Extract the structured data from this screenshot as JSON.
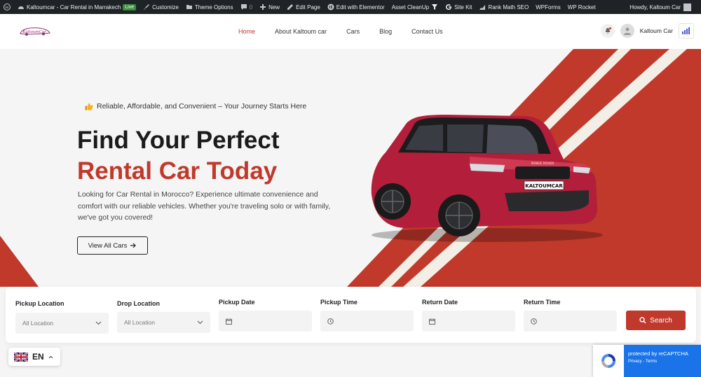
{
  "adminbar": {
    "site_name": "Kaltoumcar - Car Rental in Marrakech",
    "live_badge": "Live",
    "customize": "Customize",
    "theme_options": "Theme Options",
    "comments_count": "0",
    "new": "New",
    "edit_page": "Edit Page",
    "edit_elementor": "Edit with Elementor",
    "asset_cleanup": "Asset CleanUp",
    "site_kit": "Site Kit",
    "rank_math": "Rank Math SEO",
    "wpforms": "WPForms",
    "wp_rocket": "WP Rocket",
    "howdy": "Howdy, Kaltoum Car"
  },
  "header": {
    "logo_text": "KaltoumCar",
    "nav": [
      {
        "label": "Home",
        "active": true
      },
      {
        "label": "About Kaltoum car",
        "active": false
      },
      {
        "label": "Cars",
        "active": false
      },
      {
        "label": "Blog",
        "active": false
      },
      {
        "label": "Contact Us",
        "active": false
      }
    ],
    "user_name": "Kaltoum Car"
  },
  "hero": {
    "tagline": "Reliable, Affordable, and Convenient – Your Journey Starts Here",
    "title_line1": "Find Your Perfect",
    "title_line2": "Rental Car Today",
    "description": "Looking for Car Rental in Morocco? Experience ultimate convenience and comfort with our reliable vehicles. Whether you're traveling solo or with family, we've got you covered!",
    "cta_label": "View All Cars",
    "plate_text": "KALTOUMCAR",
    "grille_text": "RANGE ROVER"
  },
  "booking": {
    "pickup_location": {
      "label": "Pickup Location",
      "value": "All Location"
    },
    "drop_location": {
      "label": "Drop Location",
      "value": "All Location"
    },
    "pickup_date": {
      "label": "Pickup Date"
    },
    "pickup_time": {
      "label": "Pickup Time"
    },
    "return_date": {
      "label": "Return Date"
    },
    "return_time": {
      "label": "Return Time"
    },
    "search_label": "Search"
  },
  "language": {
    "code": "EN"
  },
  "recaptcha": {
    "line1": "protected by reCAPTCHA",
    "line2": "Privacy - Terms"
  },
  "colors": {
    "brand_red": "#c0392b",
    "admin_bar": "#1d2327"
  }
}
